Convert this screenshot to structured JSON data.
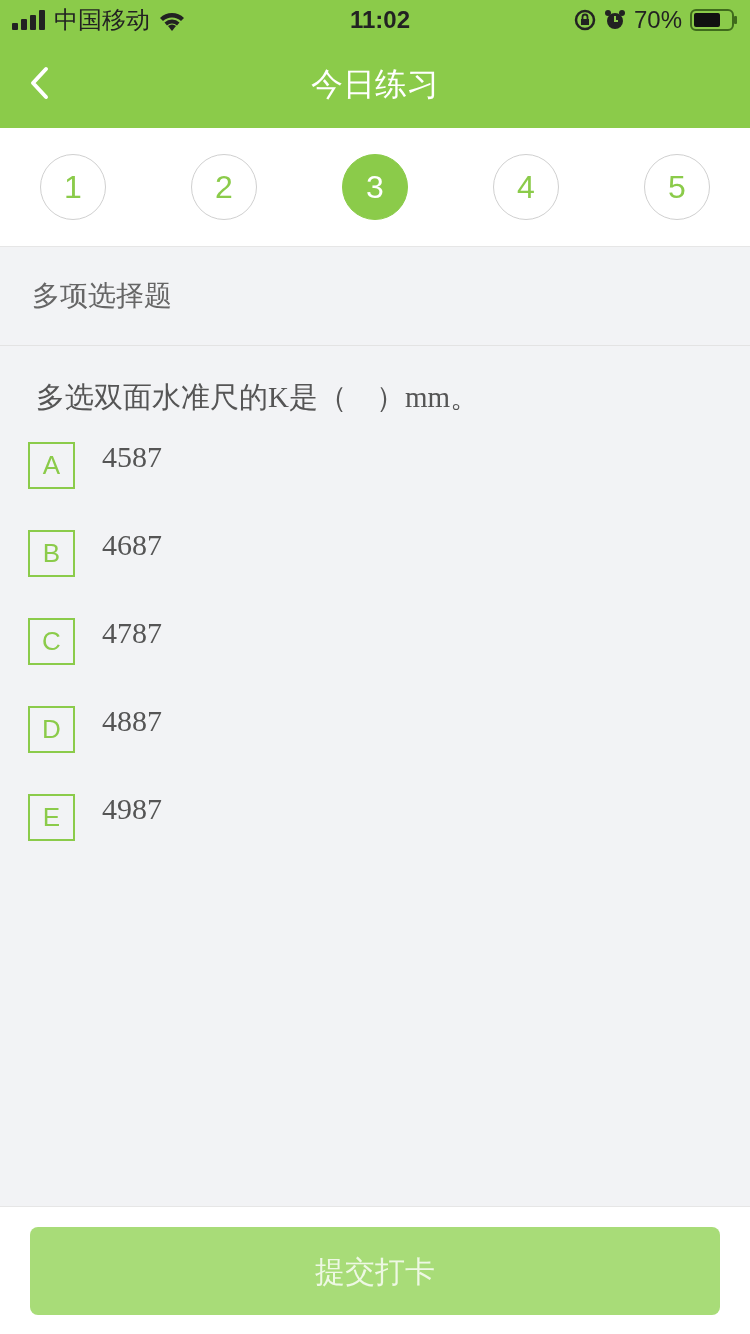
{
  "status_bar": {
    "carrier": "中国移动",
    "time": "11:02",
    "battery": "70%"
  },
  "nav": {
    "title": "今日练习"
  },
  "steps": [
    {
      "label": "1",
      "selected": false
    },
    {
      "label": "2",
      "selected": false
    },
    {
      "label": "3",
      "selected": true
    },
    {
      "label": "4",
      "selected": false
    },
    {
      "label": "5",
      "selected": false
    }
  ],
  "section": "多项选择题",
  "question": "多选双面水准尺的K是（　）mm。",
  "options": [
    {
      "letter": "A",
      "text": "4587",
      "selected": false
    },
    {
      "letter": "B",
      "text": "4687",
      "selected": false
    },
    {
      "letter": "C",
      "text": "4787",
      "selected": false
    },
    {
      "letter": "D",
      "text": "4887",
      "selected": false
    },
    {
      "letter": "E",
      "text": "4987",
      "selected": false
    }
  ],
  "submit": {
    "label": "提交打卡",
    "disabled": true
  }
}
